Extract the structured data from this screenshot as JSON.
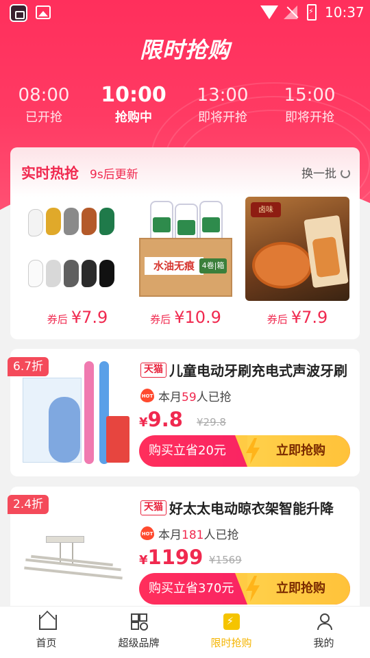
{
  "status_bar": {
    "time": "10:37"
  },
  "header": {
    "title": "限时抢购"
  },
  "time_tabs": [
    {
      "time": "08:00",
      "status": "已开抢"
    },
    {
      "time": "10:00",
      "status": "抢购中"
    },
    {
      "time": "13:00",
      "status": "即将开抢"
    },
    {
      "time": "15:00",
      "status": "即将开抢"
    }
  ],
  "hot": {
    "title": "实时热抢",
    "subtitle": "9s后更新",
    "refresh_label": "换一批",
    "items": [
      {
        "price_prefix": "券后",
        "price": "¥7.9",
        "image": "socks"
      },
      {
        "price_prefix": "券后",
        "price": "¥10.9",
        "image": "paper-towels",
        "box_text": "水油无痕",
        "box_tag": "4卷|箱"
      },
      {
        "price_prefix": "券后",
        "price": "¥7.9",
        "image": "spicy-duck-neck",
        "pack_text": "卤味"
      }
    ]
  },
  "products": [
    {
      "discount": "6.7折",
      "shop_tag": "天猫",
      "title": "儿童电动牙刷充电式声波牙刷",
      "sold_prefix": "本月",
      "sold_count": "59",
      "sold_suffix": "人已抢",
      "currency": "¥",
      "price": "9.8",
      "original_price": "¥29.8",
      "save_text": "购买立省20元",
      "buy_text": "立即抢购",
      "image": "toothbrush-set"
    },
    {
      "discount": "2.4折",
      "shop_tag": "天猫",
      "title": "好太太电动晾衣架智能升降",
      "sold_prefix": "本月",
      "sold_count": "181",
      "sold_suffix": "人已抢",
      "currency": "¥",
      "price": "1199",
      "original_price": "¥1569",
      "save_text": "购买立省370元",
      "buy_text": "立即抢购",
      "image": "drying-rack"
    }
  ],
  "bottom_nav": [
    {
      "label": "首页",
      "icon": "home-icon"
    },
    {
      "label": "超级品牌",
      "icon": "brand-icon"
    },
    {
      "label": "限时抢购",
      "icon": "flash-sale-icon",
      "active": true
    },
    {
      "label": "我的",
      "icon": "profile-icon"
    }
  ],
  "colors": {
    "primary": "#ff2f5c",
    "price": "#f0294f",
    "active_nav": "#f5b400",
    "buy_button": "#ffc23a"
  }
}
